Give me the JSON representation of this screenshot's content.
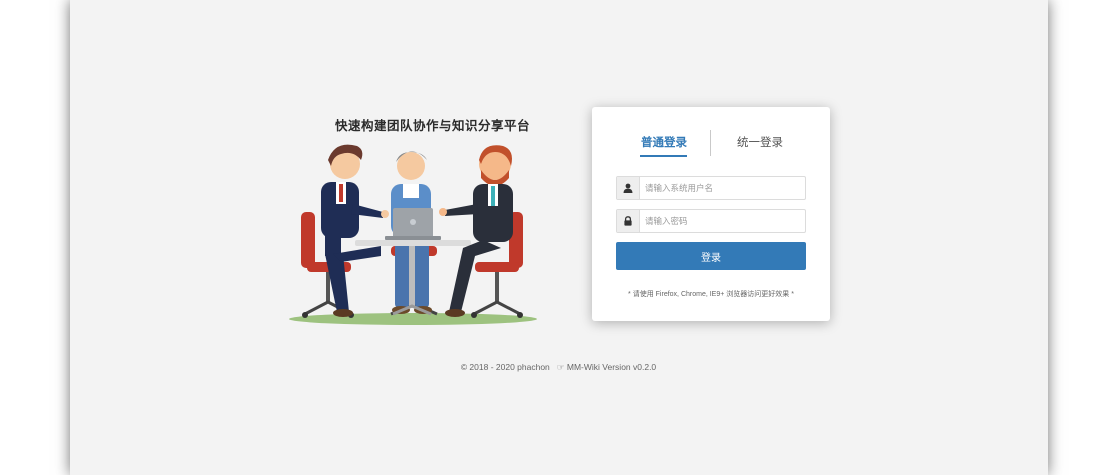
{
  "slogan": "快速构建团队协作与知识分享平台",
  "login": {
    "tabs": [
      {
        "label": "普通登录",
        "active": true
      },
      {
        "label": "统一登录",
        "active": false
      }
    ],
    "username_placeholder": "请输入系统用户名",
    "password_placeholder": "请输入密码",
    "button_label": "登录",
    "browser_tip": "* 请使用 Firefox, Chrome, IE9+ 浏览器访问更好效果 *",
    "accent_color": "#337ab7"
  },
  "icons": {
    "username": "user-icon",
    "password": "lock-icon",
    "footer_link": "hand-pointer-icon"
  },
  "footer": {
    "copyright": "© 2018 - 2020 phachon",
    "version_link": "MM-Wiki Version v0.2.0"
  }
}
